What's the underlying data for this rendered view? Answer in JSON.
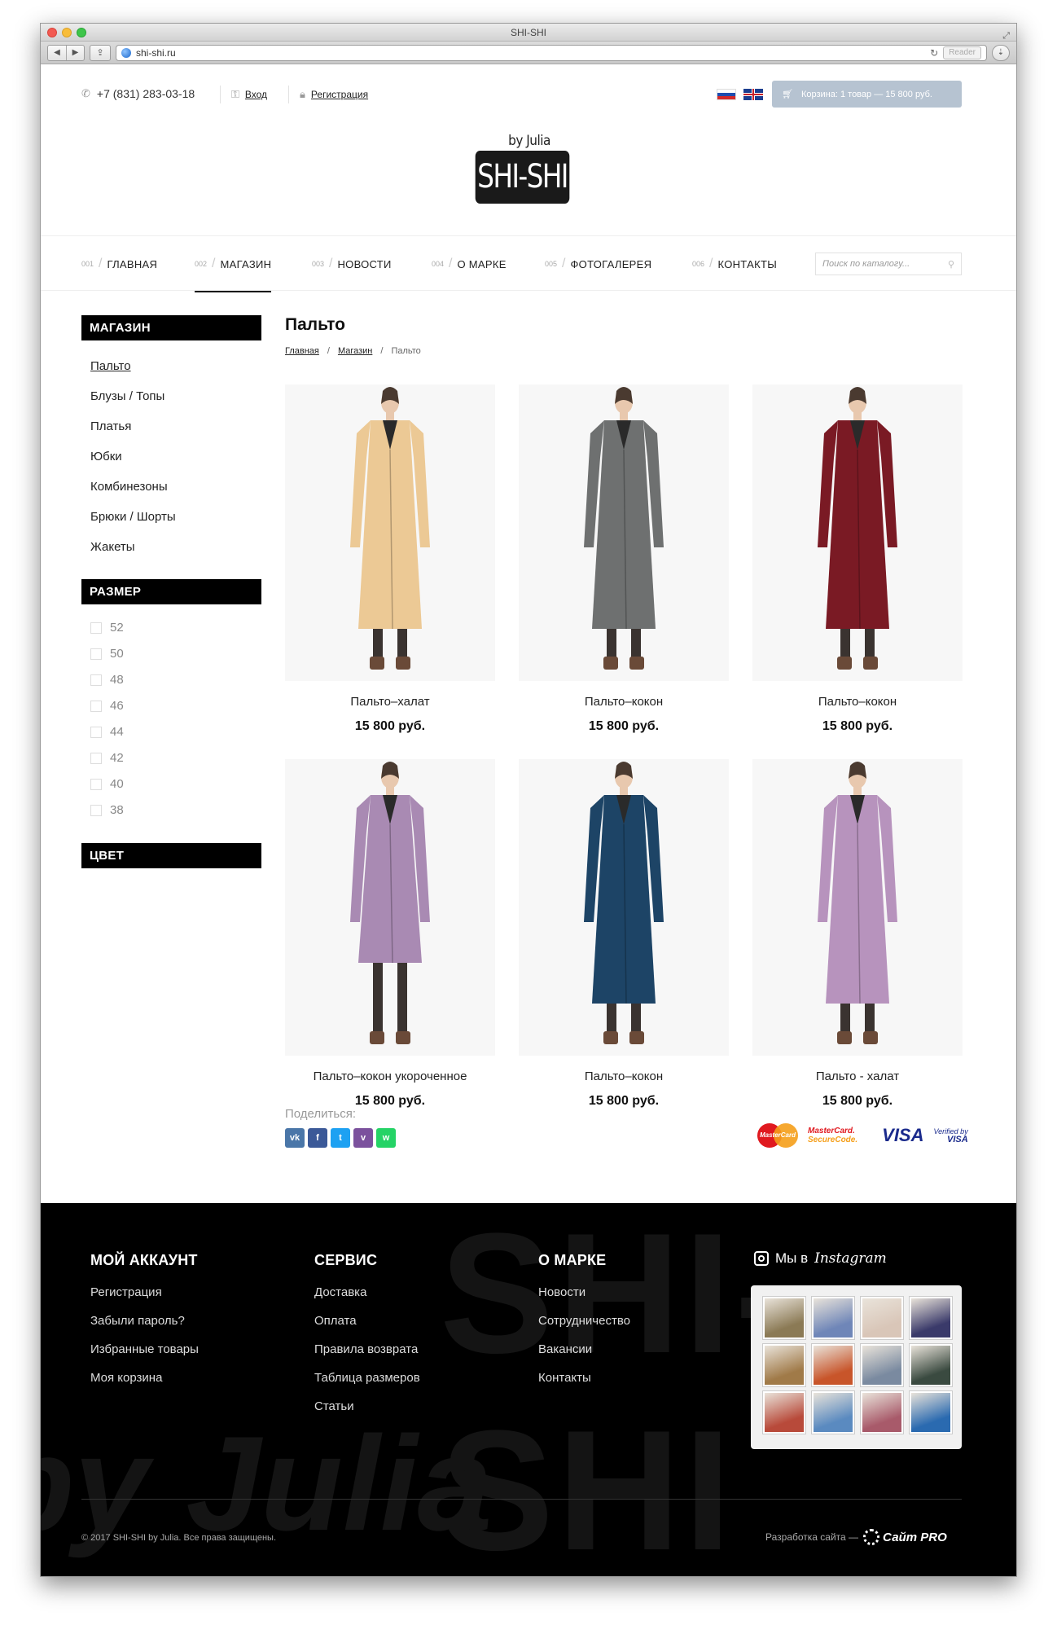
{
  "browser": {
    "window_title": "SHI-SHI",
    "url": "shi-shi.ru",
    "reader_label": "Reader"
  },
  "header": {
    "phone": "+7 (831) 283-03-18",
    "login": "Вход",
    "register": "Регистрация",
    "cart": "Корзина: 1 товар — 15 800 руб."
  },
  "logo": {
    "by_line": "by Julia",
    "brand": "SHI-SHI"
  },
  "nav": {
    "items": [
      {
        "num": "001",
        "label": "ГЛАВНАЯ"
      },
      {
        "num": "002",
        "label": "МАГАЗИН"
      },
      {
        "num": "003",
        "label": "НОВОСТИ"
      },
      {
        "num": "004",
        "label": "О МАРКЕ"
      },
      {
        "num": "005",
        "label": "ФОТОГАЛЕРЕЯ"
      },
      {
        "num": "006",
        "label": "КОНТАКТЫ"
      }
    ],
    "search_placeholder": "Поиск по каталогу..."
  },
  "sidebar": {
    "shop_title": "МАГАЗИН",
    "categories": [
      "Пальто",
      "Блузы / Топы",
      "Платья",
      "Юбки",
      "Комбинезоны",
      "Брюки / Шорты",
      "Жакеты"
    ],
    "size_title": "РАЗМЕР",
    "sizes": [
      "52",
      "50",
      "48",
      "46",
      "44",
      "42",
      "40",
      "38"
    ],
    "color_title": "ЦВЕТ"
  },
  "main": {
    "title": "Пальто",
    "breadcrumb": [
      "Главная",
      "Магазин",
      "Пальто"
    ],
    "products": [
      {
        "name": "Пальто–халат",
        "price": "15 800 руб.",
        "coat_color": "#ecc995"
      },
      {
        "name": "Пальто–кокон",
        "price": "15 800 руб.",
        "coat_color": "#6e7070"
      },
      {
        "name": "Пальто–кокон",
        "price": "15 800 руб.",
        "coat_color": "#7a1a24"
      },
      {
        "name": "Пальто–кокон укороченное",
        "price": "15 800 руб.",
        "coat_color": "#a98ab3"
      },
      {
        "name": "Пальто–кокон",
        "price": "15 800 руб.",
        "coat_color": "#1d4466"
      },
      {
        "name": "Пальто - халат",
        "price": "15 800 руб.",
        "coat_color": "#b793bd"
      }
    ],
    "share_label": "Поделиться:",
    "share_buttons": [
      {
        "label": "vk",
        "color": "#4a76a8"
      },
      {
        "label": "f",
        "color": "#3b5998"
      },
      {
        "label": "t",
        "color": "#1da1f2"
      },
      {
        "label": "v",
        "color": "#7b519d"
      },
      {
        "label": "w",
        "color": "#25d366"
      }
    ],
    "payments": {
      "mastercard": "MasterCard",
      "mc_secure_1": "MasterCard.",
      "mc_secure_2": "SecureCode.",
      "visa": "VISA",
      "vbv_1": "Verified by",
      "vbv_2": "VISA"
    }
  },
  "footer": {
    "watermark_1": "SHI-SHI",
    "watermark_2": "by Julia",
    "cols": [
      {
        "title": "МОЙ АККАУНТ",
        "links": [
          "Регистрация",
          "Забыли пароль?",
          "Избранные товары",
          "Моя корзина"
        ]
      },
      {
        "title": "СЕРВИС",
        "links": [
          "Доставка",
          "Оплата",
          "Правила возврата",
          "Таблица размеров",
          "Статьи"
        ]
      },
      {
        "title": "О МАРКЕ",
        "links": [
          "Новости",
          "Сотрудничество",
          "Вакансии",
          "Контакты"
        ]
      }
    ],
    "insta_prefix": "Мы в",
    "insta_name": "Instagram",
    "insta_thumbs": [
      "#8b7a55",
      "#6f86b8",
      "#d9c6b8",
      "#3a3a6a",
      "#a07a48",
      "#c8552a",
      "#7a8aa0",
      "#3a4a40",
      "#b84a3a",
      "#5a8ac0",
      "#a85a6a",
      "#2a6ab0"
    ],
    "copyright": "© 2017 SHI-SHI by Julia. Все права защищены.",
    "dev_prefix": "Разработка сайта —",
    "dev_name": "Сайт PRO"
  }
}
